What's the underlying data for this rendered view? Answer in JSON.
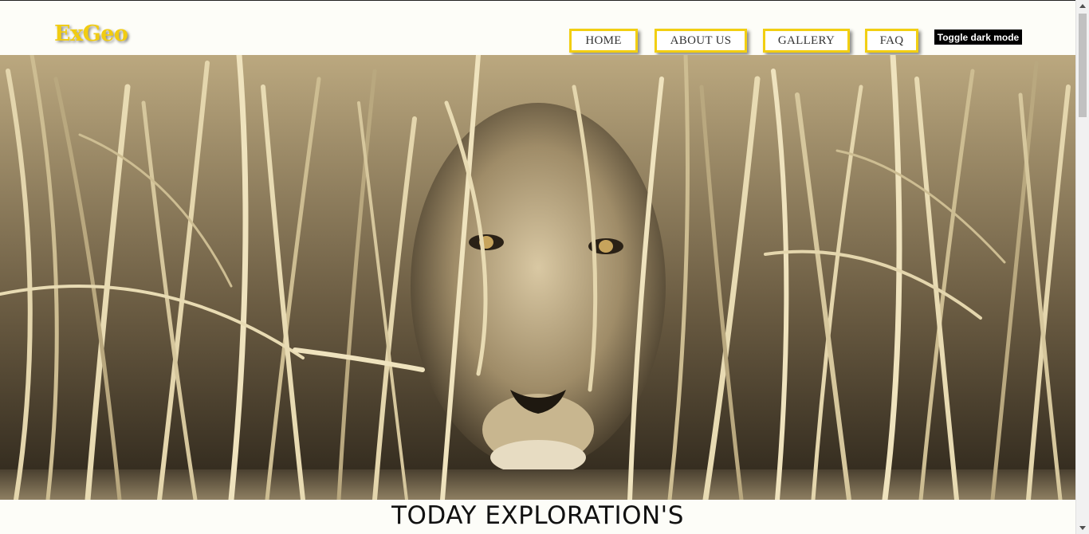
{
  "brand": {
    "logo": "ExGeo",
    "accent": "#f2cf12"
  },
  "nav": {
    "items": [
      {
        "label": "HOME"
      },
      {
        "label": "ABOUT US"
      },
      {
        "label": "GALLERY"
      },
      {
        "label": "FAQ"
      }
    ],
    "toggle_label": "Toggle dark mode"
  },
  "hero": {
    "image_subject": "lioness in tall grass drinking water, sepia tone"
  },
  "section": {
    "title": "TODAY EXPLORATION'S"
  }
}
